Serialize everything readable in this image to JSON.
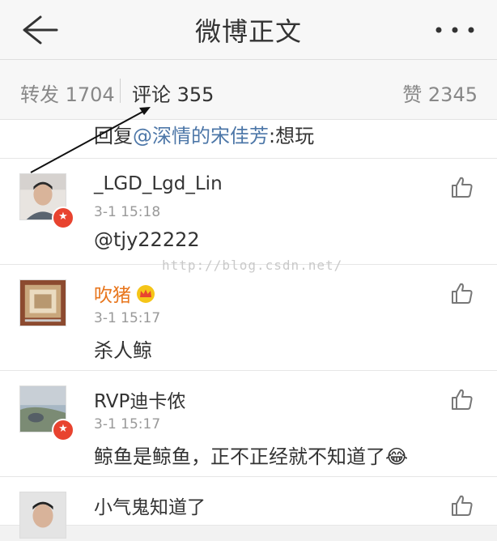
{
  "header": {
    "title": "微博正文",
    "back_icon": "arrow-left-icon",
    "more_icon": "more-dots-icon"
  },
  "tabs": {
    "repost": "转发 1704",
    "comments": "评论 355",
    "likes": "赞 2345"
  },
  "partial_comment": {
    "prefix": "回复",
    "mention": "@深情的宋佳芳",
    "suffix": ":想玩"
  },
  "comments": [
    {
      "username": "_LGD_Lgd_Lin",
      "time": "3-1 15:18",
      "body": "@tjy22222",
      "badge": true,
      "body_is_mention": true
    },
    {
      "username": "吹猪",
      "time": "3-1 15:17",
      "body": "杀人鲸",
      "vip_crown": true
    },
    {
      "username": "RVP迪卡侬",
      "time": "3-1 15:17",
      "body": "鲸鱼是鲸鱼，正不正经就不知道了😂",
      "badge": true
    },
    {
      "username": "小气鬼知道了",
      "time": "",
      "body": ""
    }
  ],
  "watermark": "http://blog.csdn.net/",
  "colors": {
    "mention": "#4d77a8",
    "vip": "#e8761d",
    "badge": "#e8432f"
  }
}
